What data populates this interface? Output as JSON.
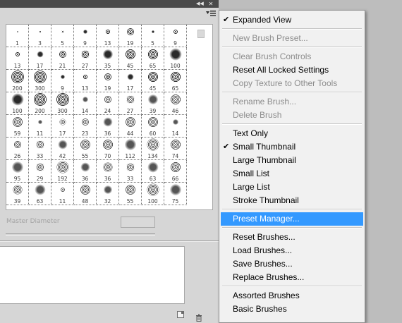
{
  "panel": {
    "master_diameter_label": "Master Diameter",
    "brush_presets": [
      {
        "size": "1",
        "r": 1
      },
      {
        "size": "3",
        "r": 1.5
      },
      {
        "size": "5",
        "r": 2
      },
      {
        "size": "9",
        "r": 3
      },
      {
        "size": "13",
        "r": 4
      },
      {
        "size": "19",
        "r": 5
      },
      {
        "size": "5",
        "r": 2
      },
      {
        "size": "9",
        "r": 3
      },
      {
        "size": "13",
        "r": 4
      },
      {
        "size": "17",
        "r": 4.5
      },
      {
        "size": "21",
        "r": 5
      },
      {
        "size": "27",
        "r": 6
      },
      {
        "size": "35",
        "r": 7
      },
      {
        "size": "45",
        "r": 7.5
      },
      {
        "size": "65",
        "r": 8
      },
      {
        "size": "100",
        "r": 8.5
      },
      {
        "size": "200",
        "r": 9
      },
      {
        "size": "300",
        "r": 9
      },
      {
        "size": "9",
        "r": 3
      },
      {
        "size": "13",
        "r": 4
      },
      {
        "size": "19",
        "r": 5
      },
      {
        "size": "17",
        "r": 4.5
      },
      {
        "size": "45",
        "r": 7.5
      },
      {
        "size": "65",
        "r": 8
      },
      {
        "size": "100",
        "r": 8.5
      },
      {
        "size": "200",
        "r": 9
      },
      {
        "size": "300",
        "r": 9
      },
      {
        "size": "14",
        "r": 4
      },
      {
        "size": "24",
        "r": 5.5
      },
      {
        "size": "27",
        "r": 6
      },
      {
        "size": "39",
        "r": 7
      },
      {
        "size": "46",
        "r": 7.5
      },
      {
        "size": "59",
        "r": 7
      },
      {
        "size": "11",
        "r": 3
      },
      {
        "size": "17",
        "r": 4.5
      },
      {
        "size": "23",
        "r": 5
      },
      {
        "size": "36",
        "r": 6.5
      },
      {
        "size": "44",
        "r": 7
      },
      {
        "size": "60",
        "r": 7.5
      },
      {
        "size": "14",
        "r": 4
      },
      {
        "size": "26",
        "r": 5.5
      },
      {
        "size": "33",
        "r": 6
      },
      {
        "size": "42",
        "r": 6.5
      },
      {
        "size": "55",
        "r": 7
      },
      {
        "size": "70",
        "r": 7.5
      },
      {
        "size": "112",
        "r": 8
      },
      {
        "size": "134",
        "r": 8.5
      },
      {
        "size": "74",
        "r": 7.5
      },
      {
        "size": "95",
        "r": 8
      },
      {
        "size": "29",
        "r": 6
      },
      {
        "size": "192",
        "r": 8.5
      },
      {
        "size": "36",
        "r": 6.5
      },
      {
        "size": "36",
        "r": 6.5
      },
      {
        "size": "33",
        "r": 6
      },
      {
        "size": "63",
        "r": 7.5
      },
      {
        "size": "66",
        "r": 7.5
      },
      {
        "size": "39",
        "r": 6.5
      },
      {
        "size": "63",
        "r": 7.5
      },
      {
        "size": "11",
        "r": 3
      },
      {
        "size": "48",
        "r": 7
      },
      {
        "size": "32",
        "r": 6
      },
      {
        "size": "55",
        "r": 7
      },
      {
        "size": "100",
        "r": 8.5
      },
      {
        "size": "75",
        "r": 8
      }
    ]
  },
  "menu": {
    "items": [
      {
        "label": "Expanded View",
        "checked": true,
        "disabled": false
      },
      {
        "label": "New Brush Preset...",
        "checked": false,
        "disabled": true
      },
      {
        "label": "Clear Brush Controls",
        "checked": false,
        "disabled": true
      },
      {
        "label": "Reset All Locked Settings",
        "checked": false,
        "disabled": false
      },
      {
        "label": "Copy Texture to Other Tools",
        "checked": false,
        "disabled": true
      },
      {
        "label": "Rename Brush...",
        "checked": false,
        "disabled": true
      },
      {
        "label": "Delete Brush",
        "checked": false,
        "disabled": true
      },
      {
        "label": "Text Only",
        "checked": false,
        "disabled": false
      },
      {
        "label": "Small Thumbnail",
        "checked": true,
        "disabled": false
      },
      {
        "label": "Large Thumbnail",
        "checked": false,
        "disabled": false
      },
      {
        "label": "Small List",
        "checked": false,
        "disabled": false
      },
      {
        "label": "Large List",
        "checked": false,
        "disabled": false
      },
      {
        "label": "Stroke Thumbnail",
        "checked": false,
        "disabled": false
      },
      {
        "label": "Preset Manager...",
        "checked": false,
        "disabled": false,
        "highlighted": true
      },
      {
        "label": "Reset Brushes...",
        "checked": false,
        "disabled": false
      },
      {
        "label": "Load Brushes...",
        "checked": false,
        "disabled": false
      },
      {
        "label": "Save Brushes...",
        "checked": false,
        "disabled": false
      },
      {
        "label": "Replace Brushes...",
        "checked": false,
        "disabled": false
      },
      {
        "label": "Assorted Brushes",
        "checked": false,
        "disabled": false
      },
      {
        "label": "Basic Brushes",
        "checked": false,
        "disabled": false
      }
    ],
    "check_glyph": "✔"
  },
  "icons": {
    "collapse": "double-chevron-right-icon",
    "close": "close-x-icon",
    "panel_menu": "panel-menu-icon",
    "new_brush": "new-preset-icon",
    "delete": "trash-icon"
  },
  "colors": {
    "highlight": "#3399ff",
    "panel_bg": "#d6d6d6",
    "menu_bg": "#f1f1f1",
    "disabled_text": "#8d8d8d"
  }
}
